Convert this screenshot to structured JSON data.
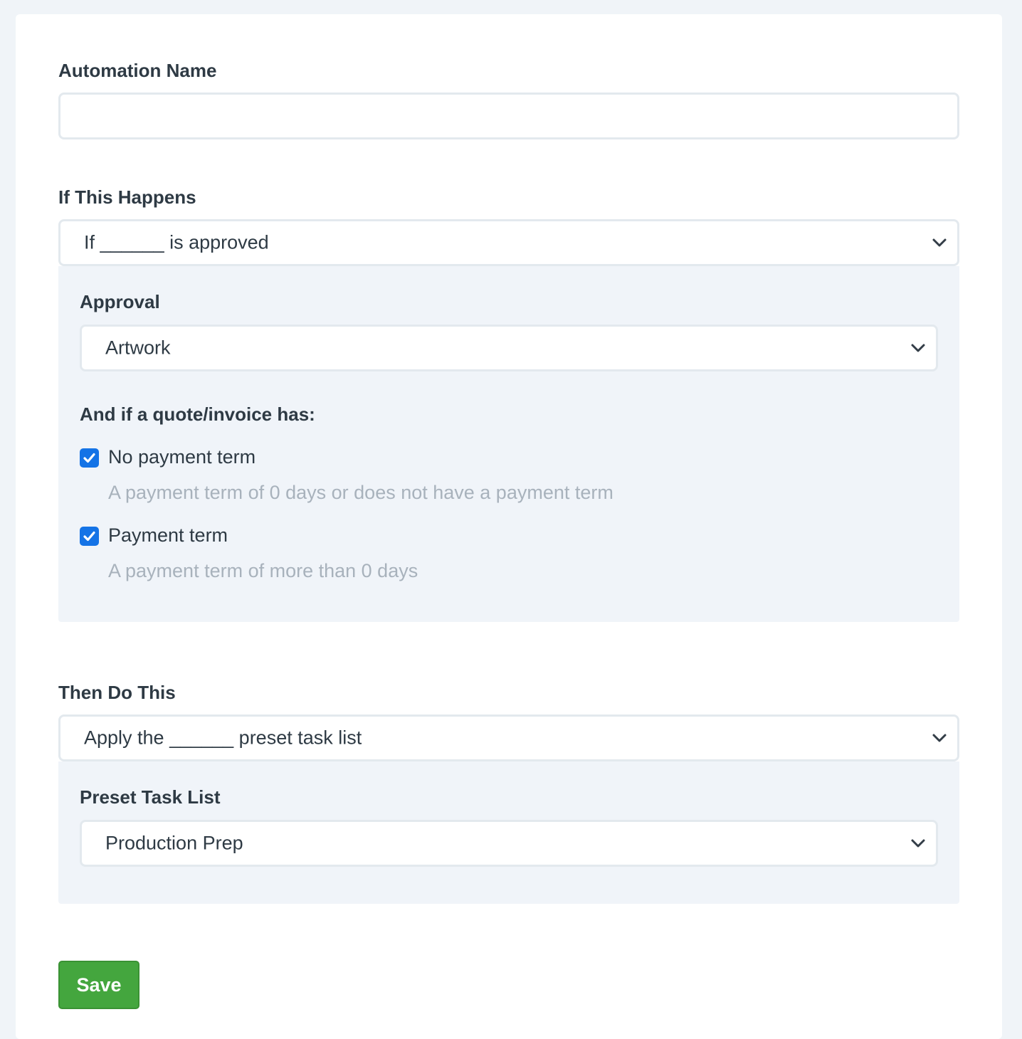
{
  "automation_name": {
    "label": "Automation Name",
    "value": "",
    "placeholder": ""
  },
  "trigger": {
    "label": "If This Happens",
    "selected": "If ______ is approved",
    "approval": {
      "label": "Approval",
      "selected": "Artwork"
    },
    "conditions": {
      "label": "And if a quote/invoice has:",
      "options": [
        {
          "label": "No payment term",
          "description": "A payment term of 0 days or does not have a payment term",
          "checked": true
        },
        {
          "label": "Payment term",
          "description": "A payment term of more than 0 days",
          "checked": true
        }
      ]
    }
  },
  "action": {
    "label": "Then Do This",
    "selected": "Apply the ______ preset task list",
    "preset_task_list": {
      "label": "Preset Task List",
      "selected": "Production Prep"
    }
  },
  "save_label": "Save",
  "colors": {
    "checkbox": "#1473e6",
    "save_button": "#44a63e",
    "panel_bg": "#f0f4f9"
  }
}
